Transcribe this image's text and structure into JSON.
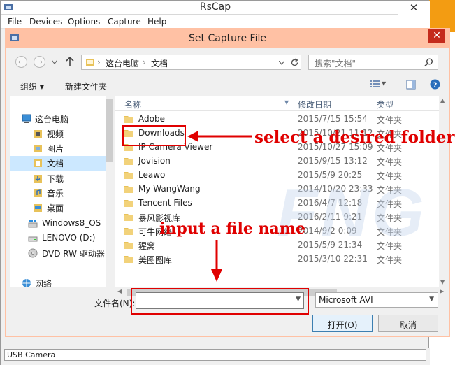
{
  "main_window": {
    "title": "RsCap",
    "close_glyph": "✕",
    "menu": [
      "File",
      "Devices",
      "Options",
      "Capture",
      "Help"
    ],
    "status": "USB Camera"
  },
  "dialog": {
    "title": "Set Capture File",
    "close_glyph": "✕",
    "breadcrumb": [
      "这台电脑",
      "文档"
    ],
    "search_placeholder": "搜索\"文档\"",
    "toolbar": {
      "organize": "组织 ▾",
      "new_folder": "新建文件夹"
    },
    "columns": {
      "name": "名称",
      "modified": "修改日期",
      "type": "类型"
    },
    "nav_items": [
      {
        "label": "这台电脑",
        "icon": "computer-icon"
      },
      {
        "label": "视频",
        "icon": "videos-folder-icon"
      },
      {
        "label": "图片",
        "icon": "pictures-folder-icon"
      },
      {
        "label": "文档",
        "icon": "documents-folder-icon"
      },
      {
        "label": "下载",
        "icon": "downloads-folder-icon"
      },
      {
        "label": "音乐",
        "icon": "music-folder-icon"
      },
      {
        "label": "桌面",
        "icon": "desktop-folder-icon"
      },
      {
        "label": "Windows8_OS",
        "icon": "drive-icon"
      },
      {
        "label": "LENOVO (D:)",
        "icon": "drive-icon"
      },
      {
        "label": "DVD RW 驱动器",
        "icon": "dvd-drive-icon"
      },
      {
        "label": "网络",
        "icon": "network-icon"
      }
    ],
    "files": [
      {
        "name": "Adobe",
        "date": "2015/7/15 15:54",
        "type": "文件夹"
      },
      {
        "name": "Downloads",
        "date": "2015/10/21 11:12",
        "type": "文件夹"
      },
      {
        "name": "IP Camera Viewer",
        "date": "2015/10/27 15:09",
        "type": "文件夹"
      },
      {
        "name": "Jovision",
        "date": "2015/9/15 13:12",
        "type": "文件夹"
      },
      {
        "name": "Leawo",
        "date": "2015/5/9 20:25",
        "type": "文件夹"
      },
      {
        "name": "My WangWang",
        "date": "2014/10/20 23:33",
        "type": "文件夹"
      },
      {
        "name": "Tencent Files",
        "date": "2016/4/7 12:18",
        "type": "文件夹"
      },
      {
        "name": "暴风影视库",
        "date": "2016/2/11 9:21",
        "type": "文件夹"
      },
      {
        "name": "可牛网络",
        "date": "2014/9/2 0:09",
        "type": "文件夹"
      },
      {
        "name": "猩窝",
        "date": "2015/5/9 21:34",
        "type": "文件夹"
      },
      {
        "name": "美图图库",
        "date": "2015/3/10 22:31",
        "type": "文件夹"
      }
    ],
    "filename_label": "文件名(N):",
    "filename_value": "",
    "filetype_value": "Microsoft AVI",
    "open_button": "打开(O)",
    "cancel_button": "取消"
  },
  "annotations": {
    "select_folder": "select a desired folder",
    "input_filename": "input a file name"
  },
  "watermark": "FNG",
  "colors": {
    "annotation": "#e00000",
    "dialog_titlebar": "#ffc1a4",
    "folder": "#e8c25a",
    "accent_strip": "#f39c12"
  }
}
